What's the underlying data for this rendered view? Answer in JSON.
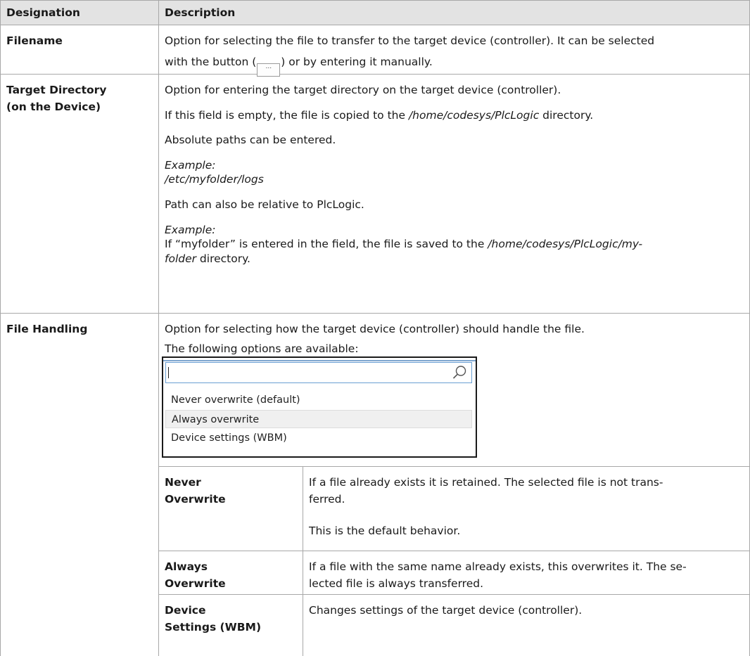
{
  "header": {
    "col1": "Designation",
    "col2": "Description"
  },
  "rows": {
    "filename": {
      "designation": "Filename",
      "line1": "Option for selecting the file to transfer to the target device (controller). It can be selected",
      "line2_pre": "with the button (",
      "button_glyph": "...",
      "line2_post": ") or by entering it manually."
    },
    "target_dir": {
      "designation_1": "Target Directory",
      "designation_2": "(on the Device)",
      "p1": "Option for entering the target directory on the target device (controller).",
      "p2_pre": "If this field is empty, the file is copied to the ",
      "p2_path": "/home/codesys/PlcLogic",
      "p2_post": " directory.",
      "p3": "Absolute paths can be entered.",
      "ex1_label": "Example:",
      "ex1_path": "/etc/myfolder/logs",
      "p4": "Path can also be relative to PlcLogic.",
      "ex2_label": "Example:",
      "ex2_pre": "If “myfolder” is entered in the field, the file is saved to the ",
      "ex2_path": "/home/codesys/PlcLogic/my-",
      "ex2_path2": "folder",
      "ex2_post": " directory."
    },
    "file_handling": {
      "designation": "File Handling",
      "p1": "Option for selecting how the target device (controller) should handle the file.",
      "p2": "The following options are available:",
      "dropdown": {
        "search_value": "",
        "options": [
          "Never overwrite (default)",
          "Always overwrite",
          "Device settings (WBM)"
        ],
        "selected_index": 1,
        "icon": "search-icon"
      },
      "sub": {
        "never": {
          "name_1": "Never",
          "name_2": "Overwrite",
          "line1": "If a file already exists it is retained. The selected file is not trans-",
          "line2": "ferred.",
          "line3": "This is the default behavior."
        },
        "always": {
          "name_1": "Always",
          "name_2": "Overwrite",
          "line1": "If a file with the same name already exists, this overwrites it. The se-",
          "line2": "lected file is always transferred."
        },
        "device": {
          "name_1": "Device",
          "name_2": "Settings (WBM)",
          "line1": "Changes settings of the target device (controller)."
        }
      }
    }
  }
}
